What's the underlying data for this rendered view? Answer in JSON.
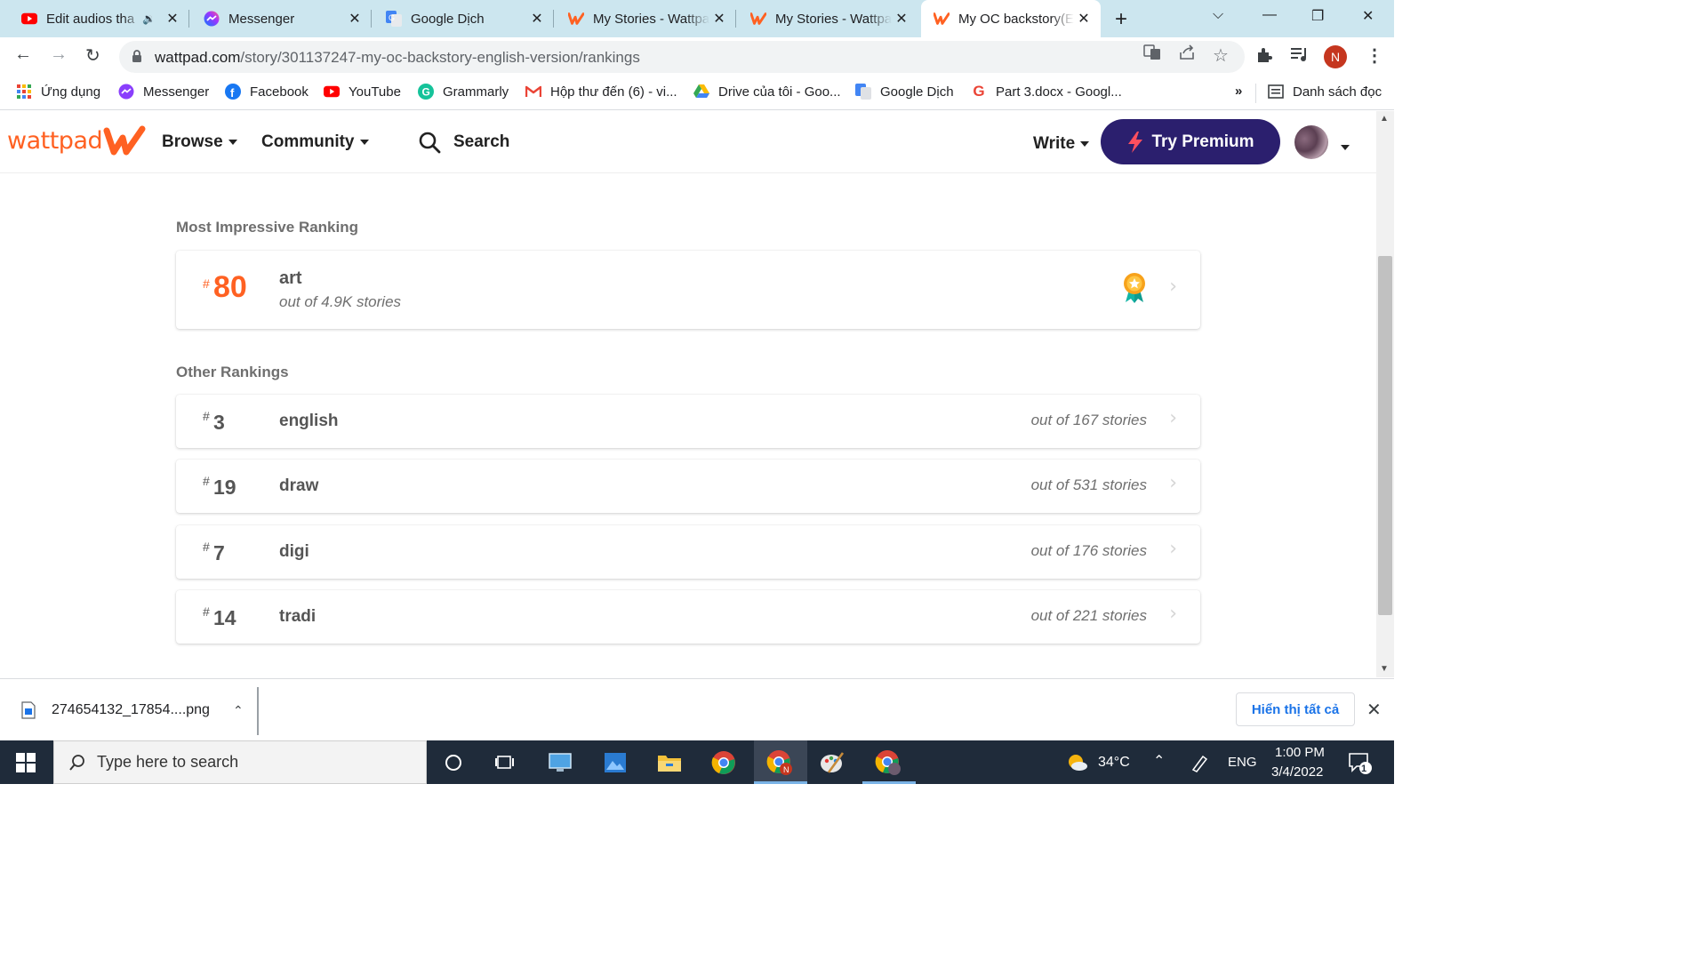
{
  "browser": {
    "tabs": [
      {
        "title": "Edit audios tha",
        "icon": "youtube-icon",
        "audio": true
      },
      {
        "title": "Messenger",
        "icon": "messenger-icon"
      },
      {
        "title": "Google Dịch",
        "icon": "google-translate-icon"
      },
      {
        "title": "My Stories - Wattpa",
        "icon": "wattpad-icon"
      },
      {
        "title": "My Stories - Wattpa",
        "icon": "wattpad-icon"
      },
      {
        "title": "My OC backstory(E",
        "icon": "wattpad-icon",
        "active": true
      }
    ],
    "url_host": "wattpad.com",
    "url_path": "/story/301137247-my-oc-backstory-english-version/rankings",
    "profile_initial": "N"
  },
  "bookmarks": [
    {
      "label": "Ứng dụng",
      "icon": "apps-grid-icon"
    },
    {
      "label": "Messenger",
      "icon": "messenger-icon"
    },
    {
      "label": "Facebook",
      "icon": "facebook-icon"
    },
    {
      "label": "YouTube",
      "icon": "youtube-icon"
    },
    {
      "label": "Grammarly",
      "icon": "grammarly-icon"
    },
    {
      "label": "Hộp thư đến (6) - vi...",
      "icon": "gmail-icon"
    },
    {
      "label": "Drive của tôi - Goo...",
      "icon": "google-drive-icon"
    },
    {
      "label": "Google Dịch",
      "icon": "google-translate-icon"
    },
    {
      "label": "Part 3.docx - Googl...",
      "icon": "google-icon"
    },
    {
      "label": "»",
      "icon": "more-bookmarks-icon"
    },
    {
      "label": "Danh sách đọc",
      "icon": "reading-list-icon"
    }
  ],
  "wattpad": {
    "logo": "wattpad",
    "nav": {
      "browse": "Browse",
      "community": "Community",
      "search": "Search",
      "write": "Write"
    },
    "premium_label": "Try Premium",
    "brand_color": "#ff6122",
    "premium_color": "#2b1f6e"
  },
  "rankings": {
    "most_label": "Most Impressive Ranking",
    "top": {
      "hash": "#",
      "rank": "80",
      "tag": "art",
      "out_of": "out of 4.9K stories"
    },
    "other_label": "Other Rankings",
    "others": [
      {
        "hash": "#",
        "rank": "3",
        "tag": "english",
        "out_of": "out of 167 stories"
      },
      {
        "hash": "#",
        "rank": "19",
        "tag": "draw",
        "out_of": "out of 531 stories"
      },
      {
        "hash": "#",
        "rank": "7",
        "tag": "digi",
        "out_of": "out of 176 stories"
      },
      {
        "hash": "#",
        "rank": "14",
        "tag": "tradi",
        "out_of": "out of 221 stories"
      }
    ]
  },
  "download_bar": {
    "filename": "274654132_17854....png",
    "show_all": "Hiển thị tất cả"
  },
  "taskbar": {
    "search_placeholder": "Type here to search",
    "weather": "34°C",
    "language": "ENG",
    "time": "1:00 PM",
    "date": "3/4/2022",
    "notifications": "1"
  }
}
